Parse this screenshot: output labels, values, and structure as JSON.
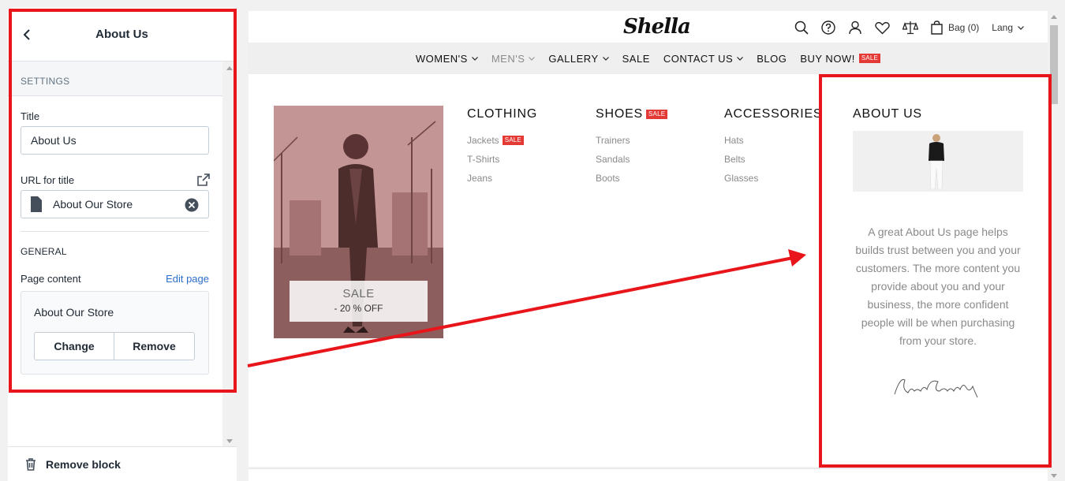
{
  "sidebar": {
    "title": "About Us",
    "settings_heading": "SETTINGS",
    "title_label": "Title",
    "title_value": "About Us",
    "url_label": "URL for title",
    "url_value": "About Our Store",
    "general_heading": "GENERAL",
    "page_content_label": "Page content",
    "edit_page_link": "Edit page",
    "page_name": "About Our Store",
    "change_button": "Change",
    "remove_button": "Remove",
    "remove_block": "Remove block"
  },
  "preview": {
    "logo": "Shella",
    "bag": "Bag (0)",
    "lang": "Lang",
    "menu": [
      {
        "label": "WOMEN'S"
      },
      {
        "label": "MEN'S"
      },
      {
        "label": "GALLERY"
      },
      {
        "label": "SALE"
      },
      {
        "label": "CONTACT US"
      },
      {
        "label": "BLOG"
      },
      {
        "label": "BUY NOW!"
      }
    ],
    "sale_badge": "SALE",
    "promo": {
      "title": "SALE",
      "subtitle": "- 20 % OFF"
    },
    "columns": [
      {
        "heading": "CLOTHING",
        "links": [
          "Jackets",
          "T-Shirts",
          "Jeans"
        ]
      },
      {
        "heading": "SHOES",
        "links": [
          "Trainers",
          "Sandals",
          "Boots"
        ]
      },
      {
        "heading": "ACCESSORIES",
        "links": [
          "Hats",
          "Belts",
          "Glasses"
        ]
      }
    ],
    "about": {
      "heading": "ABOUT US",
      "text": "A great About Us page helps builds trust between you and your customers. The more content you provide about you and your business, the more confident people will be when purchasing from your store."
    }
  },
  "colors": {
    "annotation": "#e8151b",
    "sale": "#e43a36",
    "link": "#2c6ecb"
  }
}
